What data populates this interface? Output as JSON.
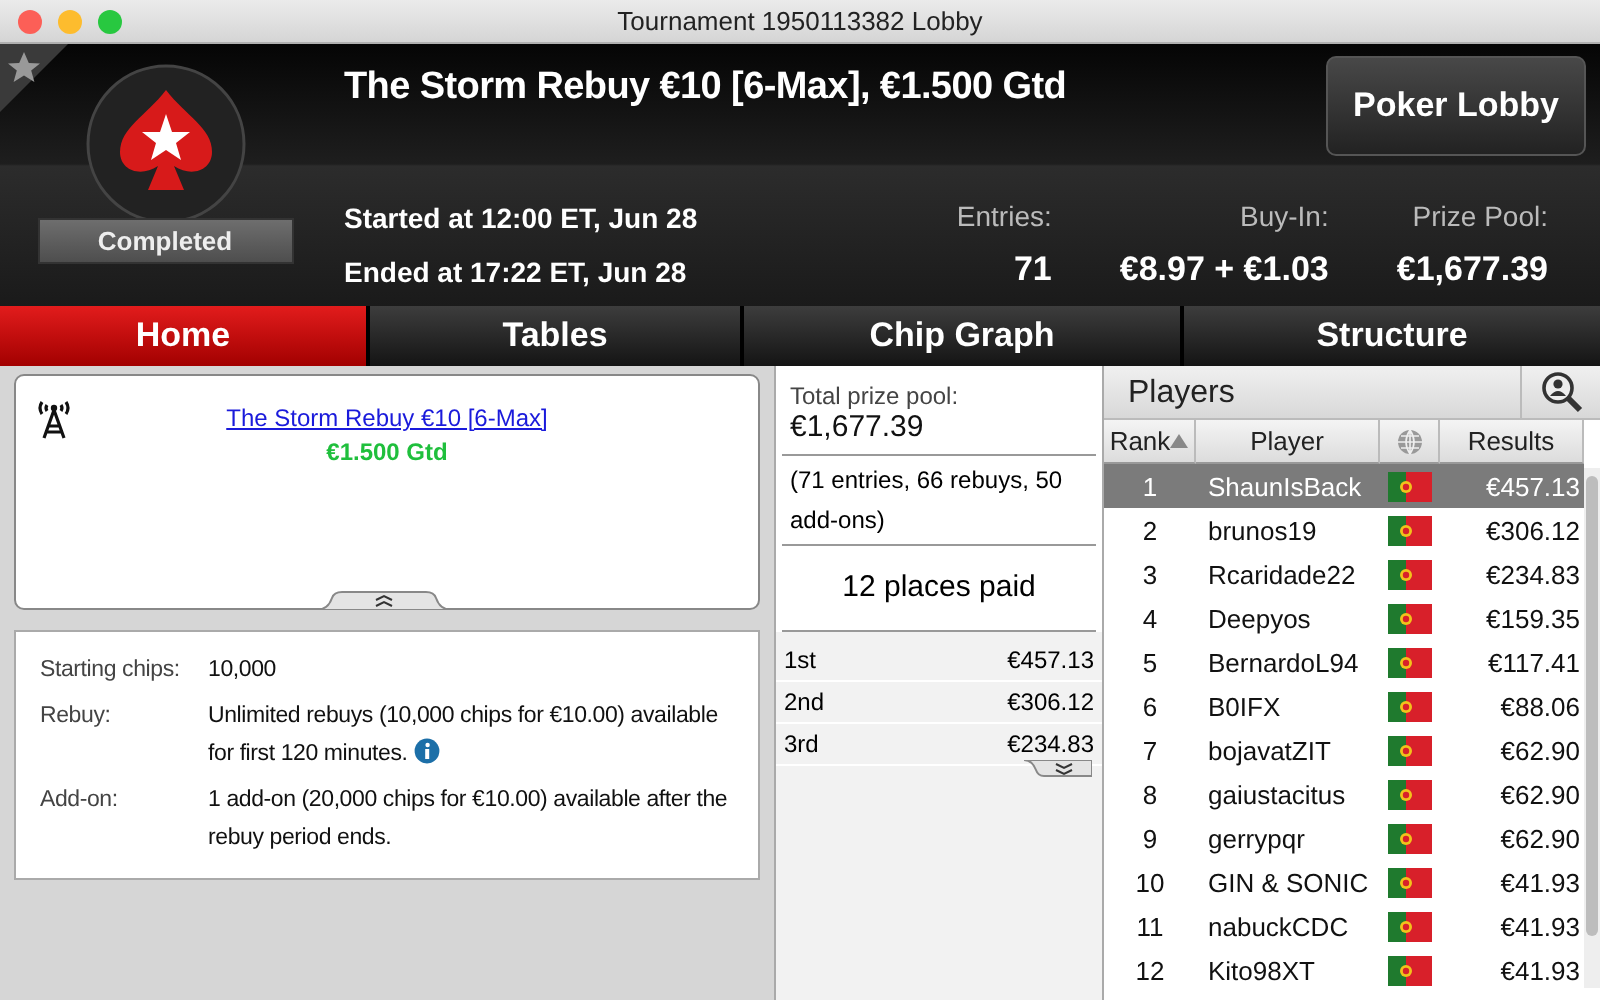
{
  "window": {
    "title": "Tournament 1950113382 Lobby"
  },
  "header": {
    "title": "The Storm Rebuy €10 [6-Max], €1.500 Gtd",
    "started": "Started at 12:00 ET, Jun 28",
    "ended": "Ended at 17:22 ET, Jun 28",
    "status": "Completed",
    "button": "Poker Lobby",
    "stats": [
      {
        "label": "Entries:",
        "value": "71"
      },
      {
        "label": "Buy-In:",
        "value": "€8.97 + €1.03"
      },
      {
        "label": "Prize Pool:",
        "value": "€1,677.39"
      }
    ]
  },
  "tabs": [
    {
      "label": "Home",
      "selected": true
    },
    {
      "label": "Tables",
      "selected": false
    },
    {
      "label": "Chip Graph",
      "selected": false
    },
    {
      "label": "Structure",
      "selected": false
    }
  ],
  "overview": {
    "link": "The Storm Rebuy €10 [6-Max]",
    "guarantee": "€1.500 Gtd"
  },
  "details": [
    {
      "label": "Starting chips:",
      "value": "10,000",
      "info": false
    },
    {
      "label": "Rebuy:",
      "value": "Unlimited rebuys (10,000 chips for €10.00) available for first 120 minutes.",
      "info": true
    },
    {
      "label": "Add-on:",
      "value": "1 add-on (20,000 chips for €10.00) available after the rebuy period ends.",
      "info": false
    }
  ],
  "prizes": {
    "label": "Total prize pool:",
    "amount": "€1,677.39",
    "breakdown": "(71 entries, 66 rebuys, 50 add-ons)",
    "places": "12 places paid",
    "payouts": [
      {
        "place": "1st",
        "amount": "€457.13"
      },
      {
        "place": "2nd",
        "amount": "€306.12"
      },
      {
        "place": "3rd",
        "amount": "€234.83"
      }
    ]
  },
  "players": {
    "title": "Players",
    "columns": [
      {
        "kind": "text",
        "label": "Rank",
        "sorted": true
      },
      {
        "kind": "text",
        "label": "Player",
        "sorted": false
      },
      {
        "kind": "icon"
      },
      {
        "kind": "text",
        "label": "Results",
        "sorted": false
      }
    ],
    "rows": [
      {
        "rank": "1",
        "name": "ShaunIsBack",
        "result": "€457.13",
        "selected": true
      },
      {
        "rank": "2",
        "name": "brunos19",
        "result": "€306.12",
        "selected": false
      },
      {
        "rank": "3",
        "name": "Rcaridade22",
        "result": "€234.83",
        "selected": false
      },
      {
        "rank": "4",
        "name": "Deepyos",
        "result": "€159.35",
        "selected": false
      },
      {
        "rank": "5",
        "name": "BernardoL94",
        "result": "€117.41",
        "selected": false
      },
      {
        "rank": "6",
        "name": "B0IFX",
        "result": "€88.06",
        "selected": false
      },
      {
        "rank": "7",
        "name": "bojavatZIT",
        "result": "€62.90",
        "selected": false
      },
      {
        "rank": "8",
        "name": "gaiustacitus",
        "result": "€62.90",
        "selected": false
      },
      {
        "rank": "9",
        "name": "gerrypqr",
        "result": "€62.90",
        "selected": false
      },
      {
        "rank": "10",
        "name": "GIN & SONIC",
        "result": "€41.93",
        "selected": false
      },
      {
        "rank": "11",
        "name": "nabuckCDC",
        "result": "€41.93",
        "selected": false
      },
      {
        "rank": "12",
        "name": "Kito98XT",
        "result": "€41.93",
        "selected": false
      }
    ]
  }
}
